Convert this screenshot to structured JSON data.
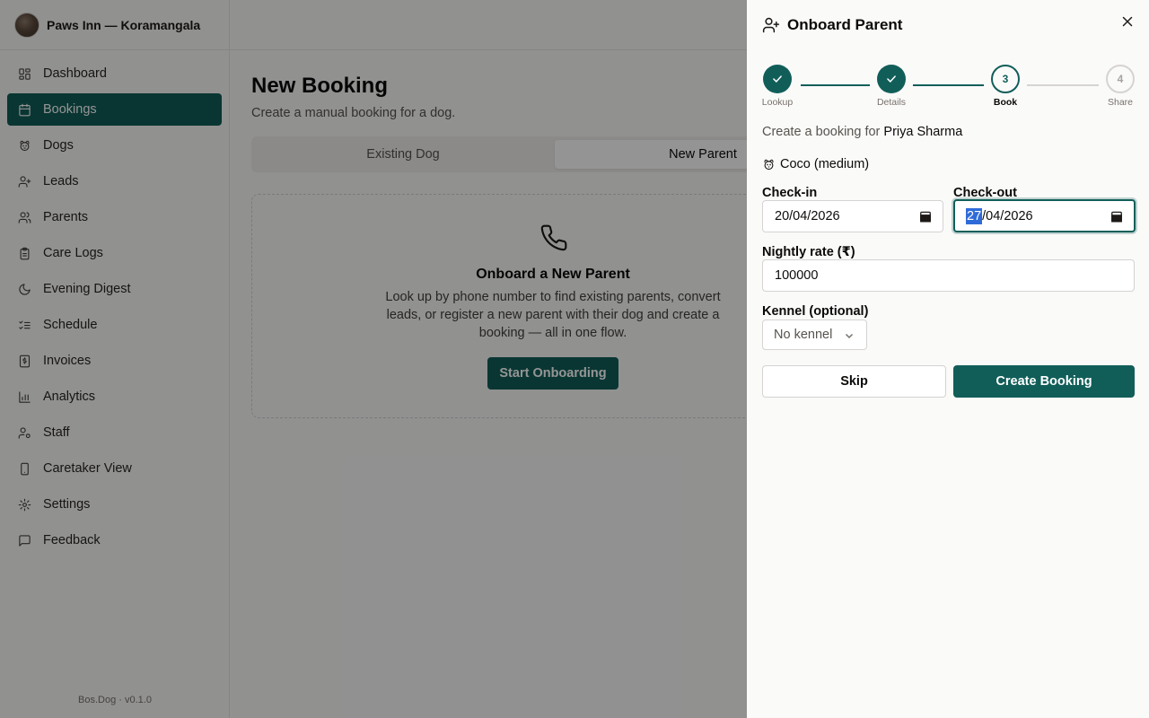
{
  "sidebar": {
    "brand": "Paws Inn — Koramangala",
    "items": [
      {
        "label": "Dashboard",
        "icon": "dashboard-icon"
      },
      {
        "label": "Bookings",
        "icon": "calendar-icon",
        "active": true
      },
      {
        "label": "Dogs",
        "icon": "dog-icon"
      },
      {
        "label": "Leads",
        "icon": "user-plus-icon"
      },
      {
        "label": "Parents",
        "icon": "users-icon"
      },
      {
        "label": "Care Logs",
        "icon": "clipboard-icon"
      },
      {
        "label": "Evening Digest",
        "icon": "moon-icon"
      },
      {
        "label": "Schedule",
        "icon": "list-checks-icon"
      },
      {
        "label": "Invoices",
        "icon": "receipt-icon"
      },
      {
        "label": "Analytics",
        "icon": "bar-chart-icon"
      },
      {
        "label": "Staff",
        "icon": "user-cog-icon"
      },
      {
        "label": "Caretaker View",
        "icon": "smartphone-icon"
      },
      {
        "label": "Settings",
        "icon": "gear-icon"
      },
      {
        "label": "Feedback",
        "icon": "message-icon"
      }
    ],
    "version": "Bos.Dog · v0.1.0"
  },
  "main": {
    "title": "New Booking",
    "subtitle": "Create a manual booking for a dog.",
    "tabs": [
      "Existing Dog",
      "New Parent"
    ],
    "card": {
      "title": "Onboard a New Parent",
      "description": "Look up by phone number to find existing parents, convert leads, or register a new parent with their dog and create a booking — all in one flow.",
      "button": "Start Onboarding"
    }
  },
  "drawer": {
    "title": "Onboard Parent",
    "steps": [
      {
        "label": "Lookup",
        "status": "done"
      },
      {
        "label": "Details",
        "status": "done"
      },
      {
        "label": "Book",
        "number": "3",
        "status": "current"
      },
      {
        "label": "Share",
        "number": "4",
        "status": "todo"
      }
    ],
    "context_prefix": "Create a booking for",
    "parent_name": "Priya Sharma",
    "dog": "Coco (medium)",
    "checkin_label": "Check-in",
    "checkin_value": "20/04/2026",
    "checkout_label": "Check-out",
    "checkout_day": "27",
    "checkout_rest": "/04/2026",
    "rate_label": "Nightly rate (₹)",
    "rate_value": "100000",
    "kennel_label": "Kennel (optional)",
    "kennel_value": "No kennel",
    "skip": "Skip",
    "create": "Create Booking"
  },
  "colors": {
    "accent": "#115e59",
    "selection": "#2f6bd8"
  }
}
